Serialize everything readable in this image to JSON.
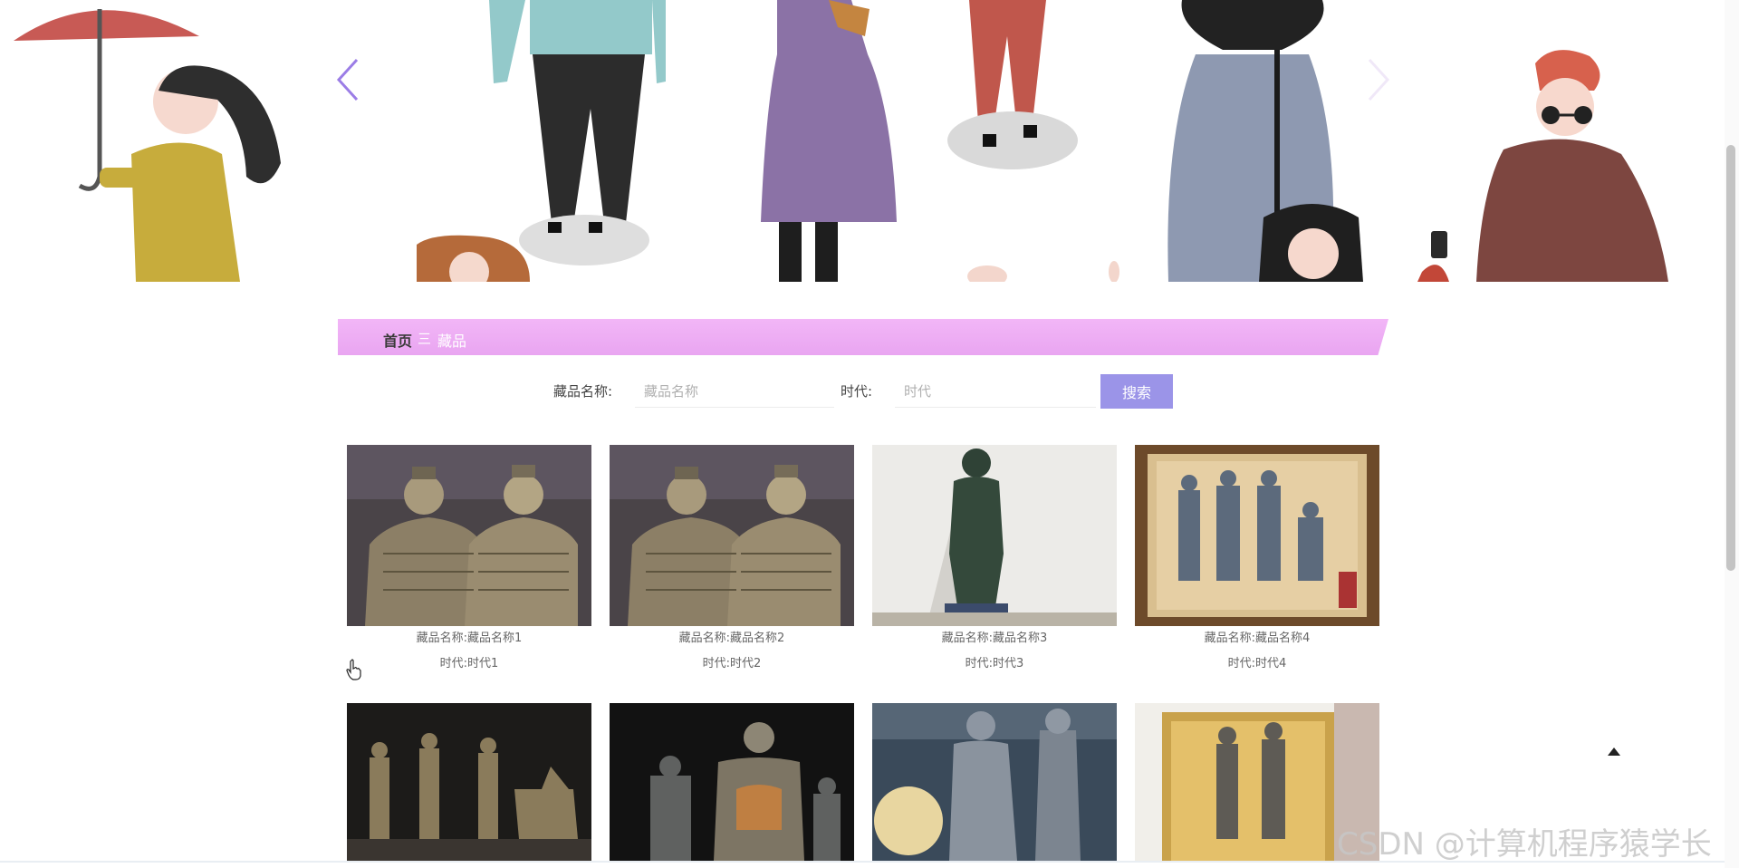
{
  "breadcrumb": {
    "home": "首页",
    "separator": "三",
    "current": "藏品"
  },
  "search": {
    "name_label": "藏品名称:",
    "name_placeholder": "藏品名称",
    "era_label": "时代:",
    "era_placeholder": "时代",
    "button": "搜索"
  },
  "items": [
    {
      "name_label": "藏品名称:",
      "name": "藏品名称1",
      "era_label": "时代:",
      "era": "时代1"
    },
    {
      "name_label": "藏品名称:",
      "name": "藏品名称2",
      "era_label": "时代:",
      "era": "时代2"
    },
    {
      "name_label": "藏品名称:",
      "name": "藏品名称3",
      "era_label": "时代:",
      "era": "时代3"
    },
    {
      "name_label": "藏品名称:",
      "name": "藏品名称4",
      "era_label": "时代:",
      "era": "时代4"
    }
  ],
  "watermark": "CSDN @计算机程序猿学长",
  "colors": {
    "accent": "#9b94e8",
    "breadcrumb_bg": "#f2b6f7",
    "arrow": "#9b7de6"
  },
  "icons": {
    "prev": "chevron-left-icon",
    "next": "chevron-right-icon",
    "back_to_top": "caret-up-icon",
    "cursor": "hand-cursor-icon"
  }
}
